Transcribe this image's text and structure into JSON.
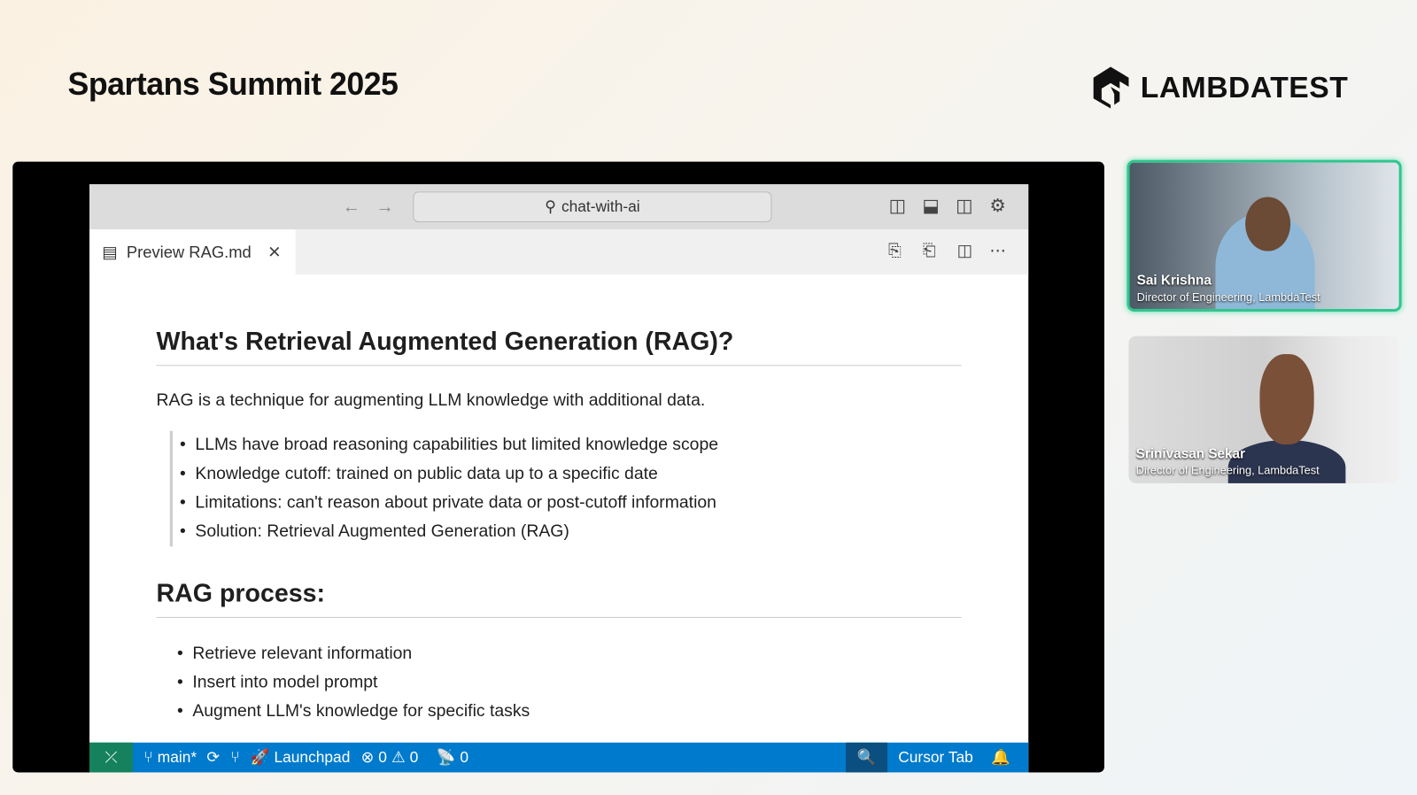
{
  "event": {
    "title": "Spartans Summit 2025",
    "logo_text": "LAMBDATEST"
  },
  "ide": {
    "search": "chat-with-ai",
    "tab": {
      "label": "Preview RAG.md"
    },
    "doc": {
      "h1": "What's Retrieval Augmented Generation (RAG)?",
      "intro": "RAG is a technique for augmenting LLM knowledge with additional data.",
      "bullets1": [
        "LLMs have broad reasoning capabilities but limited knowledge scope",
        "Knowledge cutoff: trained on public data up to a specific date",
        "Limitations: can't reason about private data or post-cutoff information",
        "Solution: Retrieval Augmented Generation (RAG)"
      ],
      "h2": "RAG process:",
      "bullets2": [
        "Retrieve relevant information",
        "Insert into model prompt",
        "Augment LLM's knowledge for specific tasks"
      ]
    },
    "status": {
      "branch": "main*",
      "launchpad": "Launchpad",
      "errors": "0",
      "warnings": "0",
      "ports": "0",
      "cursor_tab": "Cursor Tab"
    }
  },
  "participants": [
    {
      "name": "Sai Krishna",
      "role": "Director of Engineering, LambdaTest"
    },
    {
      "name": "Srinivasan Sekar",
      "role": "Director of Engineering, LambdaTest"
    }
  ]
}
